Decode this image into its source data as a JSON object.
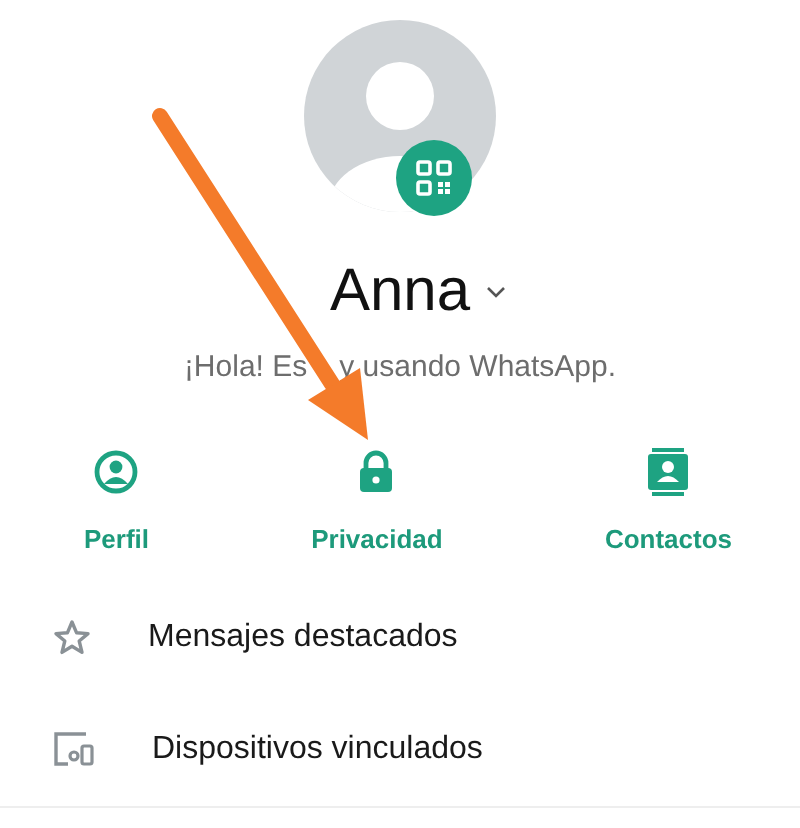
{
  "profile": {
    "name": "Anna",
    "status_parts": [
      "¡Hola! Es",
      "y usando WhatsApp."
    ]
  },
  "actions": [
    {
      "kind": "profile",
      "label": "Perfil"
    },
    {
      "kind": "privacy",
      "label": "Privacidad"
    },
    {
      "kind": "contacts",
      "label": "Contactos"
    }
  ],
  "menu": [
    {
      "kind": "starred",
      "label": "Mensajes destacados"
    },
    {
      "kind": "devices",
      "label": "Dispositivos vinculados"
    }
  ]
}
